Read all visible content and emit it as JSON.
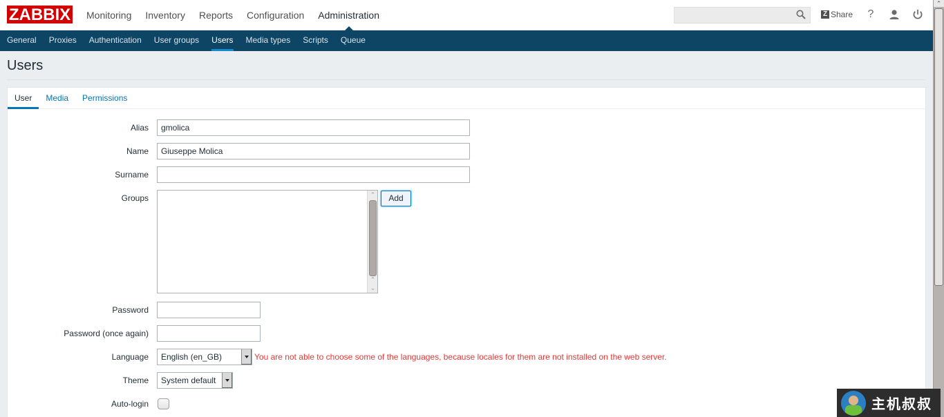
{
  "header": {
    "logo": "ZABBIX",
    "main_nav": [
      "Monitoring",
      "Inventory",
      "Reports",
      "Configuration",
      "Administration"
    ],
    "active_main": "Administration",
    "search": {
      "value": "",
      "placeholder": ""
    },
    "share_label": "Share",
    "share_badge": "Z",
    "help_glyph": "?",
    "icons": [
      "search-icon",
      "share-icon",
      "help-icon",
      "user-profile-icon",
      "logout-icon"
    ]
  },
  "subnav": {
    "items": [
      "General",
      "Proxies",
      "Authentication",
      "User groups",
      "Users",
      "Media types",
      "Scripts",
      "Queue"
    ],
    "active": "Users"
  },
  "page": {
    "title": "Users"
  },
  "tabs": {
    "items": [
      "User",
      "Media",
      "Permissions"
    ],
    "active": "User"
  },
  "form": {
    "alias": {
      "label": "Alias",
      "value": "gmolica"
    },
    "name": {
      "label": "Name",
      "value": "Giuseppe Molica"
    },
    "surname": {
      "label": "Surname",
      "value": ""
    },
    "groups": {
      "label": "Groups",
      "items": [],
      "add_label": "Add"
    },
    "password": {
      "label": "Password",
      "value": ""
    },
    "password_again": {
      "label": "Password (once again)",
      "value": ""
    },
    "language": {
      "label": "Language",
      "selected": "English (en_GB)",
      "warning": "You are not able to choose some of the languages, because locales for them are not installed on the web server."
    },
    "theme": {
      "label": "Theme",
      "selected": "System default"
    },
    "autologin": {
      "label": "Auto-login",
      "checked": false
    }
  },
  "watermark": {
    "text": "主机叔叔"
  },
  "colors": {
    "brand_red": "#d40000",
    "nav_dark": "#0e4565",
    "active_underline": "#1689cd",
    "link_blue": "#0275b8",
    "warning_red": "#e33734",
    "page_bg": "#ebeef0"
  }
}
